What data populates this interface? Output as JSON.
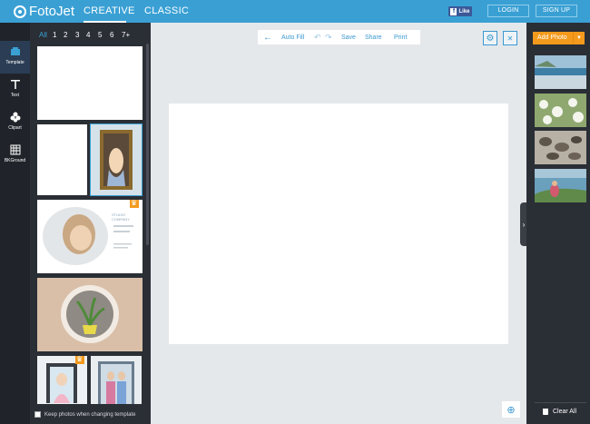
{
  "header": {
    "logo": "FotoJet",
    "tabs": [
      {
        "label": "CREATIVE"
      },
      {
        "label": "CLASSIC"
      }
    ],
    "facebook": {
      "f": "f",
      "like": "Like"
    },
    "login": "LOGIN",
    "signup": "SIGN UP"
  },
  "tools": [
    {
      "label": "Template",
      "icon": "template-icon"
    },
    {
      "label": "Text",
      "icon": "text-icon"
    },
    {
      "label": "Clipart",
      "icon": "clipart-icon"
    },
    {
      "label": "BKGround",
      "icon": "background-icon"
    }
  ],
  "template_panel": {
    "filters": [
      "All",
      "1",
      "2",
      "3",
      "4",
      "5",
      "6",
      "7+"
    ],
    "templates": [
      {
        "name": "blank-wide"
      },
      {
        "name": "blank-tall"
      },
      {
        "name": "couple-frame"
      },
      {
        "name": "girl-portrait-premium",
        "title": "STUDIO COMPANY"
      },
      {
        "name": "plant-cup"
      },
      {
        "name": "girl-frame-premium"
      },
      {
        "name": "family-frame"
      }
    ],
    "keep_photos": "Keep photos when changing template"
  },
  "edit_bar": {
    "auto_fill": "Auto Fill",
    "save": "Save",
    "share": "Share",
    "print": "Print",
    "back_icon": "←",
    "undo_icon": "↶",
    "redo_icon": "↷"
  },
  "settings_icon": "⚙",
  "close_icon": "✕",
  "zoom_icon": "⊕",
  "photo_panel": {
    "add_photo": "Add Photo",
    "add_photo_arrow": "▼",
    "collapse_icon": "›",
    "photos": [
      {
        "name": "beach-photo"
      },
      {
        "name": "flowers-photo"
      },
      {
        "name": "stones-photo"
      },
      {
        "name": "woman-coast-photo"
      }
    ],
    "clear_all": "Clear All"
  }
}
